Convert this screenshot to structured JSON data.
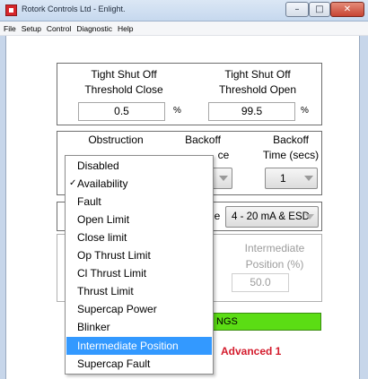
{
  "window": {
    "title": "Rotork Controls Ltd - Enlight.",
    "minimize_glyph": "–",
    "maximize_glyph": "□",
    "close_glyph": "✕"
  },
  "menu": [
    "File",
    "Setup",
    "Control",
    "Diagnostic",
    "Help"
  ],
  "threshold": {
    "close_label_1": "Tight Shut Off",
    "close_label_2": "Threshold Close",
    "close_value": "0.5",
    "close_unit": "%",
    "open_label_1": "Tight Shut Off",
    "open_label_2": "Threshold Open",
    "open_value": "99.5",
    "open_unit": "%"
  },
  "obstruction": {
    "obstruction_label": "Obstruction",
    "backoff_distance_label_1": "Backoff",
    "backoff_distance_label_2_visible": "ce",
    "backoff_time_label_1": "Backoff",
    "backoff_time_label_2": "Time (secs)",
    "backoff_time_value": "1"
  },
  "control_source": {
    "partial_label": "e",
    "value": "4 - 20 mA & ESD"
  },
  "intermediate": {
    "label_1": "Intermediate",
    "label_2": "Position (%)",
    "value": "50.0"
  },
  "status": {
    "text_visible": "NGS",
    "color": "#5bdd14"
  },
  "advanced_label": "Advanced 1",
  "dropdown": {
    "items": [
      {
        "label": "Disabled",
        "checked": false,
        "selected": false
      },
      {
        "label": "Availability",
        "checked": true,
        "selected": false
      },
      {
        "label": "Fault",
        "checked": false,
        "selected": false
      },
      {
        "label": "Open Limit",
        "checked": false,
        "selected": false
      },
      {
        "label": "Close limit",
        "checked": false,
        "selected": false
      },
      {
        "label": "Op Thrust Limit",
        "checked": false,
        "selected": false
      },
      {
        "label": "Cl Thrust Limit",
        "checked": false,
        "selected": false
      },
      {
        "label": "Thrust Limit",
        "checked": false,
        "selected": false
      },
      {
        "label": "Supercap Power",
        "checked": false,
        "selected": false
      },
      {
        "label": "Blinker",
        "checked": false,
        "selected": false
      },
      {
        "label": "Intermediate Position",
        "checked": false,
        "selected": true
      },
      {
        "label": "Supercap Fault",
        "checked": false,
        "selected": false
      }
    ],
    "check_glyph": "✓",
    "highlight_color": "#3399ff"
  }
}
